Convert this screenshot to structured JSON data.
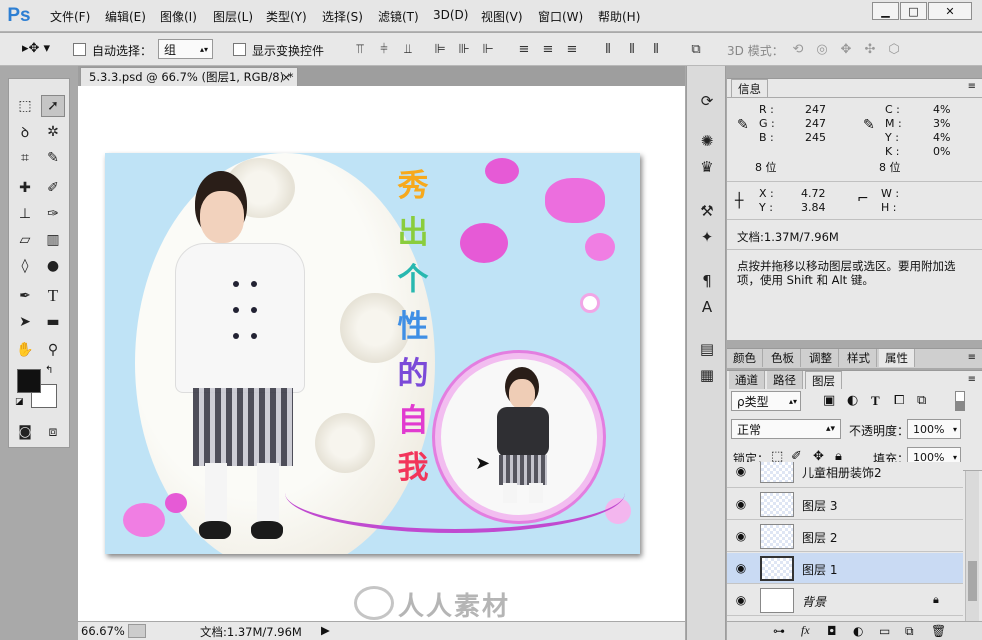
{
  "app": {
    "logo": "Ps"
  },
  "menu": [
    "文件(F)",
    "编辑(E)",
    "图像(I)",
    "图层(L)",
    "类型(Y)",
    "选择(S)",
    "滤镜(T)",
    "3D(D)",
    "视图(V)",
    "窗口(W)",
    "帮助(H)"
  ],
  "window_controls": {
    "minimize": "▁",
    "restore": "□",
    "close": "✕"
  },
  "options": {
    "auto_select_label": "自动选择：",
    "auto_select_value": "组",
    "show_transform_label": "显示变换控件",
    "mode_3d_label": "3D 模式："
  },
  "document": {
    "tab_title": "5.3.3.psd @ 66.7% (图层1, RGB/8) *",
    "tab_close": "×",
    "zoom": "66.67%",
    "doc_size": "文档:1.37M/7.96M"
  },
  "artwork": {
    "vertical_text": [
      "秀",
      "出",
      "个",
      "性",
      "的",
      "自",
      "我"
    ],
    "vertical_colors": [
      "#f7a91c",
      "#8acd3c",
      "#28b8b0",
      "#3f8fe5",
      "#7b4ad8",
      "#e13bd0",
      "#f2355a"
    ]
  },
  "watermark": {
    "text": "人人素材"
  },
  "info_panel": {
    "tab": "信息",
    "R": "247",
    "G": "247",
    "B": "245",
    "C": "4%",
    "M": "3%",
    "Y": "4%",
    "K": "0%",
    "bit_left": "8 位",
    "bit_right": "8 位",
    "X": "4.72",
    "Ycoord": "3.84",
    "W": "",
    "H": "",
    "doc": "文档:1.37M/7.96M",
    "hint": "点按并拖移以移动图层或选区。要用附加选项，使用 Shift 和 Alt 键。"
  },
  "panel_tabs_1": [
    "颜色",
    "色板",
    "调整",
    "样式",
    "属性"
  ],
  "panel_tabs_2": [
    "通道",
    "路径",
    "图层"
  ],
  "layers_panel": {
    "kind": "ρ类型",
    "blend": "正常",
    "opacity_label": "不透明度：",
    "opacity": "100%",
    "lock_label": "锁定：",
    "fill_label": "填充：",
    "fill": "100%",
    "layers": [
      {
        "name": "儿童相册装饰2",
        "selected": false
      },
      {
        "name": "图层 3",
        "selected": false
      },
      {
        "name": "图层 2",
        "selected": false
      },
      {
        "name": "图层 1",
        "selected": true
      },
      {
        "name": "背景",
        "selected": false
      }
    ]
  },
  "colors": {
    "selected_layer": "#c9daf3",
    "canvas_bg": "#bfe3f6",
    "accent": "#e55ad7"
  }
}
